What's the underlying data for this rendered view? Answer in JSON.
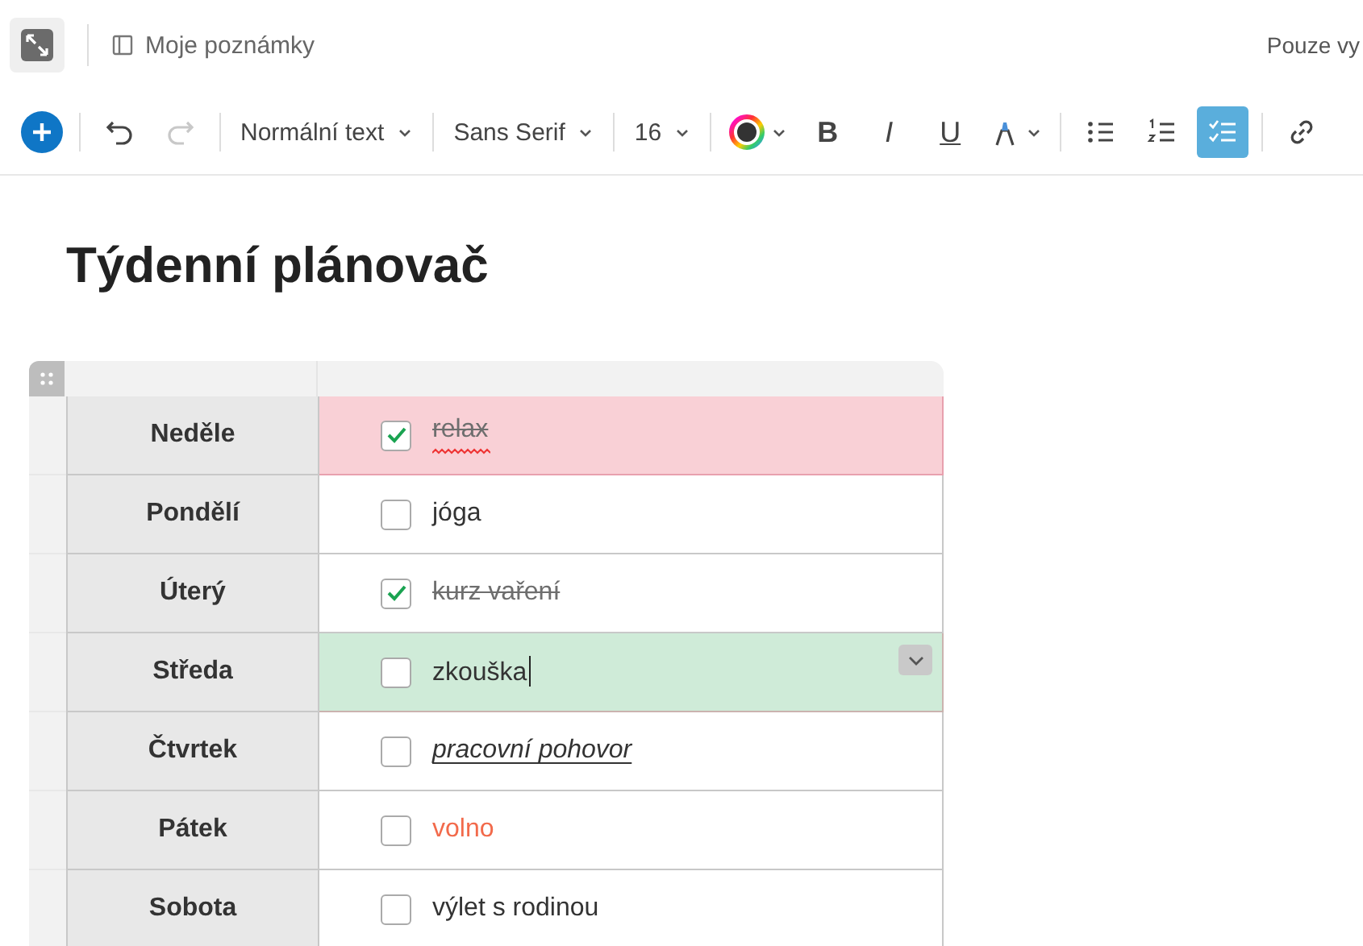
{
  "header": {
    "breadcrumb": "Moje poznámky",
    "sharing": "Pouze vy"
  },
  "toolbar": {
    "items": [
      {
        "kind": "add"
      },
      {
        "kind": "undo",
        "disabled": false
      },
      {
        "kind": "redo",
        "disabled": true
      },
      {
        "kind": "dropdown",
        "label": "Normální text"
      },
      {
        "kind": "dropdown",
        "label": "Sans Serif"
      },
      {
        "kind": "dropdown",
        "label": "16"
      },
      {
        "kind": "color"
      },
      {
        "kind": "bold",
        "label": "B"
      },
      {
        "kind": "italic",
        "label": "I"
      },
      {
        "kind": "underline",
        "label": "U"
      },
      {
        "kind": "highlight"
      },
      {
        "kind": "bullets",
        "selected": false
      },
      {
        "kind": "numbers",
        "selected": false
      },
      {
        "kind": "checklist",
        "selected": true
      },
      {
        "kind": "link"
      }
    ]
  },
  "title": "Týdenní plánovač",
  "table": {
    "rows": [
      {
        "day": "Neděle",
        "task": "relax",
        "checked": true,
        "color": "#f9d0d6",
        "misspelled": true,
        "italic": false,
        "underline": false,
        "editing": false,
        "accent_text": false
      },
      {
        "day": "Pondělí",
        "task": "jóga",
        "checked": false,
        "color": "#ffffff",
        "misspelled": false,
        "italic": false,
        "underline": false,
        "editing": false,
        "accent_text": false
      },
      {
        "day": "Úterý",
        "task": "kurz vaření",
        "checked": true,
        "color": "#ffffff",
        "misspelled": false,
        "italic": false,
        "underline": false,
        "editing": false,
        "accent_text": false
      },
      {
        "day": "Středa",
        "task": "zkouška",
        "checked": false,
        "color": "#cfebd8",
        "misspelled": false,
        "italic": false,
        "underline": false,
        "editing": true,
        "accent_text": false
      },
      {
        "day": "Čtvrtek",
        "task": "pracovní pohovor",
        "checked": false,
        "color": "#ffffff",
        "misspelled": false,
        "italic": true,
        "underline": true,
        "editing": false,
        "accent_text": false
      },
      {
        "day": "Pátek",
        "task": "volno",
        "checked": false,
        "color": "#ffffff",
        "misspelled": false,
        "italic": false,
        "underline": false,
        "editing": false,
        "accent_text": true
      },
      {
        "day": "Sobota",
        "task": "výlet s rodinou",
        "checked": false,
        "color": "#ffffff",
        "misspelled": false,
        "italic": false,
        "underline": false,
        "editing": false,
        "accent_text": false
      }
    ]
  }
}
